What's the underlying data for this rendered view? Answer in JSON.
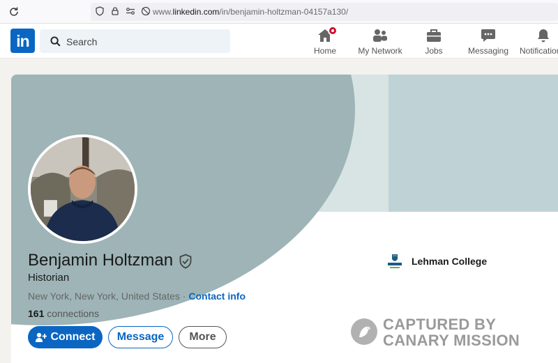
{
  "browser": {
    "url_prefix": "www.",
    "url_domain": "linkedin.com",
    "url_path": "/in/benjamin-holtzman-04157a130/"
  },
  "nav": {
    "search_placeholder": "Search",
    "items": [
      {
        "label": "Home",
        "icon": "home-icon"
      },
      {
        "label": "My Network",
        "icon": "network-icon"
      },
      {
        "label": "Jobs",
        "icon": "briefcase-icon"
      },
      {
        "label": "Messaging",
        "icon": "chat-icon"
      },
      {
        "label": "Notifications",
        "icon": "bell-icon"
      }
    ]
  },
  "profile": {
    "name": "Benjamin Holtzman",
    "headline": "Historian",
    "location": "New York, New York, United States",
    "separator": " · ",
    "contact_info": "Contact info",
    "connections_count": "161",
    "connections_label": " connections",
    "school": "Lehman College",
    "buttons": {
      "connect": "Connect",
      "message": "Message",
      "more": "More"
    }
  },
  "watermark": {
    "line1": "CAPTURED BY",
    "line2": "CANARY MISSION"
  },
  "colors": {
    "brand": "#0a66c2",
    "badge": "#cb112d"
  }
}
